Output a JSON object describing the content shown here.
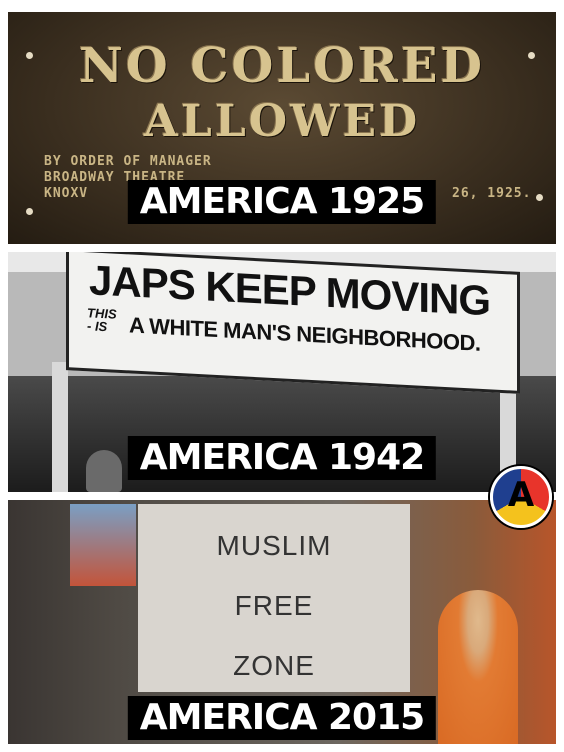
{
  "panels": [
    {
      "plaque_line1": "NO COLORED",
      "plaque_line2": "ALLOWED",
      "small_line1": "BY ORDER OF MANAGER",
      "small_line2": "BROADWAY THEATRE",
      "small_line3": "KNOXV",
      "small_date": "26, 1925.",
      "caption": "AMERICA 1925"
    },
    {
      "sign_line1": "JAPS KEEP MOVING",
      "sign_this": "THIS",
      "sign_is": "- IS",
      "sign_line2": "A WHITE MAN'S NEIGHBORHOOD.",
      "caption": "AMERICA 1942"
    },
    {
      "sign_word1": "MUSLIM",
      "sign_word2": "FREE",
      "sign_word3": "ZONE",
      "caption": "AMERICA 2015"
    }
  ],
  "logo_letter": "A",
  "colors": {
    "caption_bg": "#000000",
    "caption_text": "#ffffff",
    "plaque_text": "#d7c38f",
    "logo_red": "#e8342b",
    "logo_yellow": "#f4c21d",
    "logo_blue": "#1f3f8f"
  }
}
